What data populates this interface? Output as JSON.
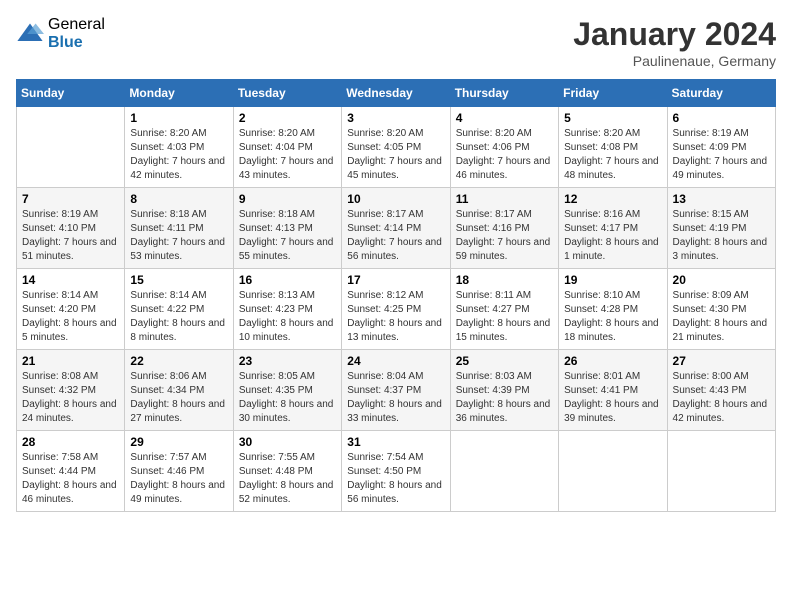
{
  "header": {
    "logo_general": "General",
    "logo_blue": "Blue",
    "month_title": "January 2024",
    "location": "Paulinenaue, Germany"
  },
  "days_of_week": [
    "Sunday",
    "Monday",
    "Tuesday",
    "Wednesday",
    "Thursday",
    "Friday",
    "Saturday"
  ],
  "weeks": [
    [
      {
        "day": "",
        "sunrise": "",
        "sunset": "",
        "daylight": ""
      },
      {
        "day": "1",
        "sunrise": "Sunrise: 8:20 AM",
        "sunset": "Sunset: 4:03 PM",
        "daylight": "Daylight: 7 hours and 42 minutes."
      },
      {
        "day": "2",
        "sunrise": "Sunrise: 8:20 AM",
        "sunset": "Sunset: 4:04 PM",
        "daylight": "Daylight: 7 hours and 43 minutes."
      },
      {
        "day": "3",
        "sunrise": "Sunrise: 8:20 AM",
        "sunset": "Sunset: 4:05 PM",
        "daylight": "Daylight: 7 hours and 45 minutes."
      },
      {
        "day": "4",
        "sunrise": "Sunrise: 8:20 AM",
        "sunset": "Sunset: 4:06 PM",
        "daylight": "Daylight: 7 hours and 46 minutes."
      },
      {
        "day": "5",
        "sunrise": "Sunrise: 8:20 AM",
        "sunset": "Sunset: 4:08 PM",
        "daylight": "Daylight: 7 hours and 48 minutes."
      },
      {
        "day": "6",
        "sunrise": "Sunrise: 8:19 AM",
        "sunset": "Sunset: 4:09 PM",
        "daylight": "Daylight: 7 hours and 49 minutes."
      }
    ],
    [
      {
        "day": "7",
        "sunrise": "Sunrise: 8:19 AM",
        "sunset": "Sunset: 4:10 PM",
        "daylight": "Daylight: 7 hours and 51 minutes."
      },
      {
        "day": "8",
        "sunrise": "Sunrise: 8:18 AM",
        "sunset": "Sunset: 4:11 PM",
        "daylight": "Daylight: 7 hours and 53 minutes."
      },
      {
        "day": "9",
        "sunrise": "Sunrise: 8:18 AM",
        "sunset": "Sunset: 4:13 PM",
        "daylight": "Daylight: 7 hours and 55 minutes."
      },
      {
        "day": "10",
        "sunrise": "Sunrise: 8:17 AM",
        "sunset": "Sunset: 4:14 PM",
        "daylight": "Daylight: 7 hours and 56 minutes."
      },
      {
        "day": "11",
        "sunrise": "Sunrise: 8:17 AM",
        "sunset": "Sunset: 4:16 PM",
        "daylight": "Daylight: 7 hours and 59 minutes."
      },
      {
        "day": "12",
        "sunrise": "Sunrise: 8:16 AM",
        "sunset": "Sunset: 4:17 PM",
        "daylight": "Daylight: 8 hours and 1 minute."
      },
      {
        "day": "13",
        "sunrise": "Sunrise: 8:15 AM",
        "sunset": "Sunset: 4:19 PM",
        "daylight": "Daylight: 8 hours and 3 minutes."
      }
    ],
    [
      {
        "day": "14",
        "sunrise": "Sunrise: 8:14 AM",
        "sunset": "Sunset: 4:20 PM",
        "daylight": "Daylight: 8 hours and 5 minutes."
      },
      {
        "day": "15",
        "sunrise": "Sunrise: 8:14 AM",
        "sunset": "Sunset: 4:22 PM",
        "daylight": "Daylight: 8 hours and 8 minutes."
      },
      {
        "day": "16",
        "sunrise": "Sunrise: 8:13 AM",
        "sunset": "Sunset: 4:23 PM",
        "daylight": "Daylight: 8 hours and 10 minutes."
      },
      {
        "day": "17",
        "sunrise": "Sunrise: 8:12 AM",
        "sunset": "Sunset: 4:25 PM",
        "daylight": "Daylight: 8 hours and 13 minutes."
      },
      {
        "day": "18",
        "sunrise": "Sunrise: 8:11 AM",
        "sunset": "Sunset: 4:27 PM",
        "daylight": "Daylight: 8 hours and 15 minutes."
      },
      {
        "day": "19",
        "sunrise": "Sunrise: 8:10 AM",
        "sunset": "Sunset: 4:28 PM",
        "daylight": "Daylight: 8 hours and 18 minutes."
      },
      {
        "day": "20",
        "sunrise": "Sunrise: 8:09 AM",
        "sunset": "Sunset: 4:30 PM",
        "daylight": "Daylight: 8 hours and 21 minutes."
      }
    ],
    [
      {
        "day": "21",
        "sunrise": "Sunrise: 8:08 AM",
        "sunset": "Sunset: 4:32 PM",
        "daylight": "Daylight: 8 hours and 24 minutes."
      },
      {
        "day": "22",
        "sunrise": "Sunrise: 8:06 AM",
        "sunset": "Sunset: 4:34 PM",
        "daylight": "Daylight: 8 hours and 27 minutes."
      },
      {
        "day": "23",
        "sunrise": "Sunrise: 8:05 AM",
        "sunset": "Sunset: 4:35 PM",
        "daylight": "Daylight: 8 hours and 30 minutes."
      },
      {
        "day": "24",
        "sunrise": "Sunrise: 8:04 AM",
        "sunset": "Sunset: 4:37 PM",
        "daylight": "Daylight: 8 hours and 33 minutes."
      },
      {
        "day": "25",
        "sunrise": "Sunrise: 8:03 AM",
        "sunset": "Sunset: 4:39 PM",
        "daylight": "Daylight: 8 hours and 36 minutes."
      },
      {
        "day": "26",
        "sunrise": "Sunrise: 8:01 AM",
        "sunset": "Sunset: 4:41 PM",
        "daylight": "Daylight: 8 hours and 39 minutes."
      },
      {
        "day": "27",
        "sunrise": "Sunrise: 8:00 AM",
        "sunset": "Sunset: 4:43 PM",
        "daylight": "Daylight: 8 hours and 42 minutes."
      }
    ],
    [
      {
        "day": "28",
        "sunrise": "Sunrise: 7:58 AM",
        "sunset": "Sunset: 4:44 PM",
        "daylight": "Daylight: 8 hours and 46 minutes."
      },
      {
        "day": "29",
        "sunrise": "Sunrise: 7:57 AM",
        "sunset": "Sunset: 4:46 PM",
        "daylight": "Daylight: 8 hours and 49 minutes."
      },
      {
        "day": "30",
        "sunrise": "Sunrise: 7:55 AM",
        "sunset": "Sunset: 4:48 PM",
        "daylight": "Daylight: 8 hours and 52 minutes."
      },
      {
        "day": "31",
        "sunrise": "Sunrise: 7:54 AM",
        "sunset": "Sunset: 4:50 PM",
        "daylight": "Daylight: 8 hours and 56 minutes."
      },
      {
        "day": "",
        "sunrise": "",
        "sunset": "",
        "daylight": ""
      },
      {
        "day": "",
        "sunrise": "",
        "sunset": "",
        "daylight": ""
      },
      {
        "day": "",
        "sunrise": "",
        "sunset": "",
        "daylight": ""
      }
    ]
  ]
}
